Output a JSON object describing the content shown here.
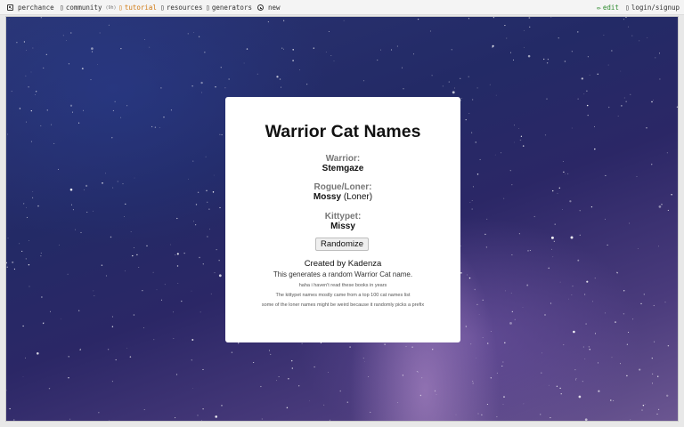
{
  "topbar": {
    "brand": "perchance",
    "community": "community",
    "community_count": "(9h)",
    "tutorial": "tutorial",
    "resources": "resources",
    "generators": "generators",
    "new": "new",
    "edit": "edit",
    "login": "login/signup"
  },
  "colors": {
    "tutorial": "#d07a14",
    "edit": "#2e8b2e"
  },
  "card": {
    "title": "Warrior Cat Names",
    "warrior_label": "Warrior:",
    "warrior_value": "Stemgaze",
    "rogue_label": "Rogue/Loner:",
    "rogue_name": "Mossy",
    "rogue_suffix": "(Loner)",
    "kittypet_label": "Kittypet:",
    "kittypet_value": "Missy",
    "button": "Randomize",
    "creator": "Created by Kadenza",
    "description": "This generates a random Warrior Cat name.",
    "notes": [
      "haha i haven't read these books in years",
      "The kittypet names mostly came from a top 100 cat names list",
      "some of the loner names might be weird because it randomly picks a prefix"
    ]
  }
}
